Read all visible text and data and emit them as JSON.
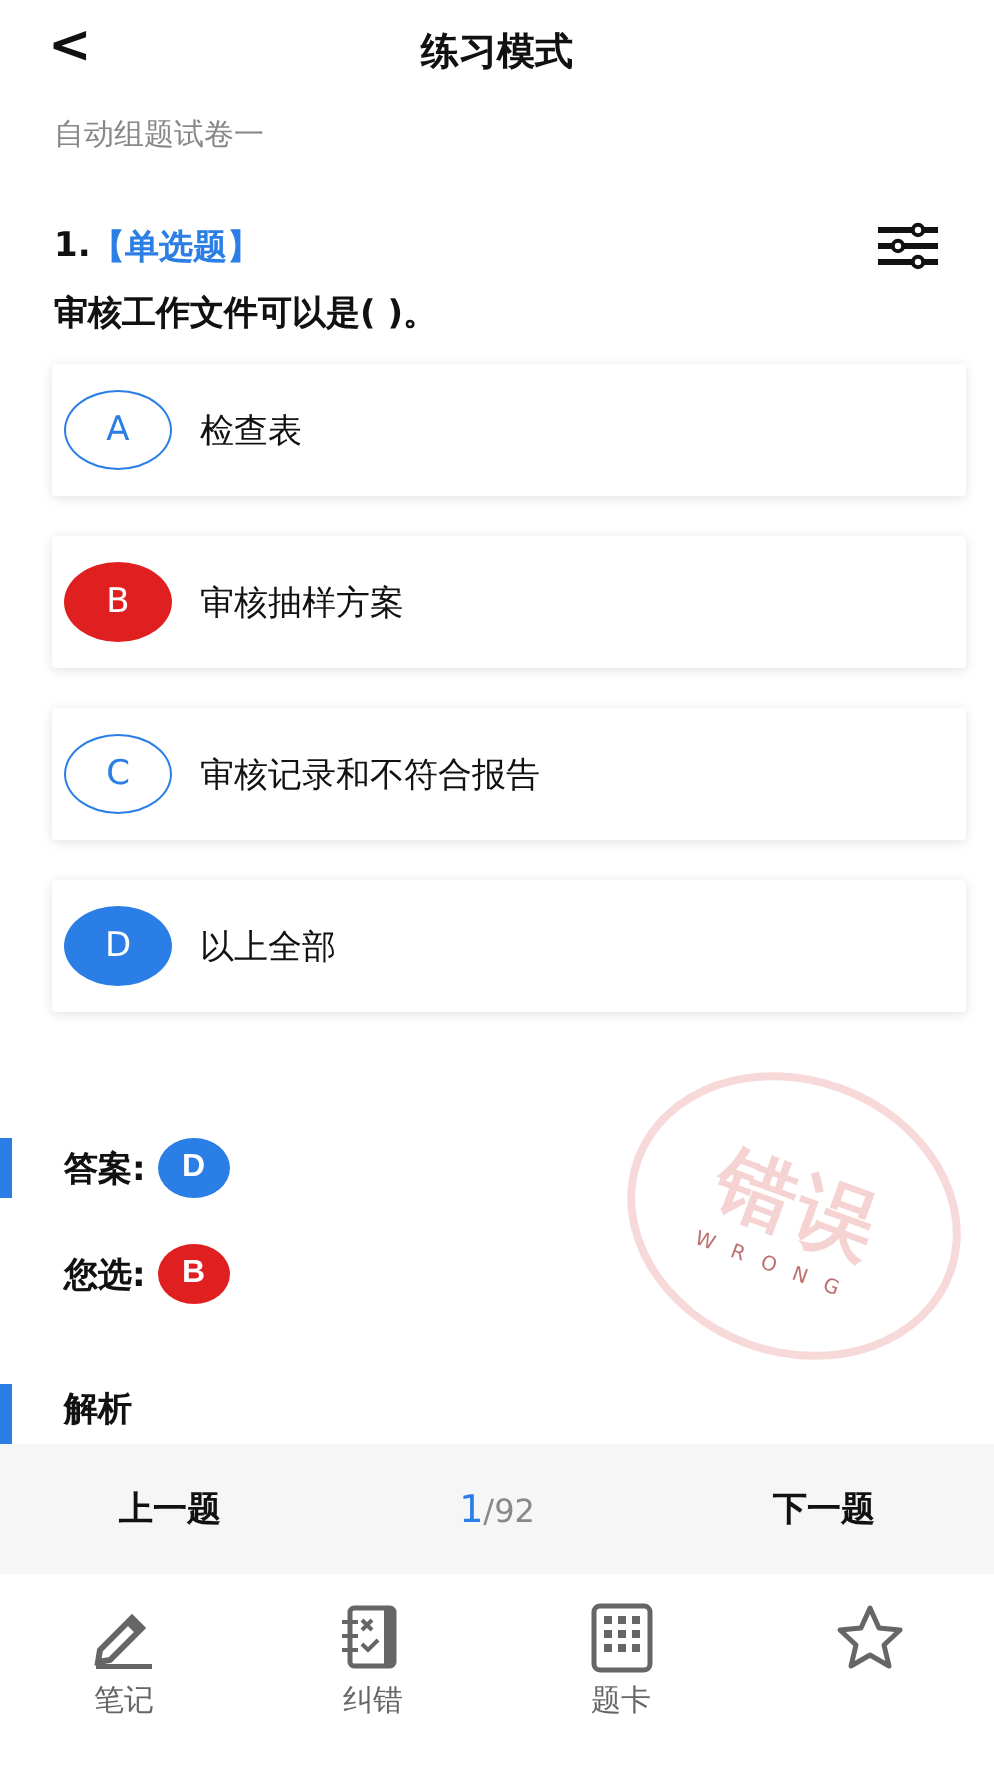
{
  "header": {
    "back": "<",
    "title": "练习模式"
  },
  "paper_title": "自动组题试卷一",
  "question": {
    "number": "1.",
    "type": "【单选题】",
    "text": "审核工作文件可以是( )。"
  },
  "options": [
    {
      "letter": "A",
      "text": "检查表",
      "selected": false,
      "correct": false
    },
    {
      "letter": "B",
      "text": "审核抽样方案",
      "selected": true,
      "correct": false
    },
    {
      "letter": "C",
      "text": "审核记录和不符合报告",
      "selected": false,
      "correct": false
    },
    {
      "letter": "D",
      "text": "以上全部",
      "selected": false,
      "correct": true
    }
  ],
  "result": {
    "answer_label": "答案:",
    "answer": "D",
    "chosen_label": "您选:",
    "chosen": "B",
    "stamp": {
      "text": "错误",
      "subtext": "WRONG"
    }
  },
  "analysis_title": "解析",
  "nav": {
    "prev": "上一题",
    "current": "1",
    "total": "/92",
    "next": "下一题"
  },
  "tabs": [
    {
      "kind": "note",
      "label": "笔记"
    },
    {
      "kind": "correction",
      "label": "纠错"
    },
    {
      "kind": "card",
      "label": "题卡"
    },
    {
      "kind": "favorite"
    }
  ]
}
